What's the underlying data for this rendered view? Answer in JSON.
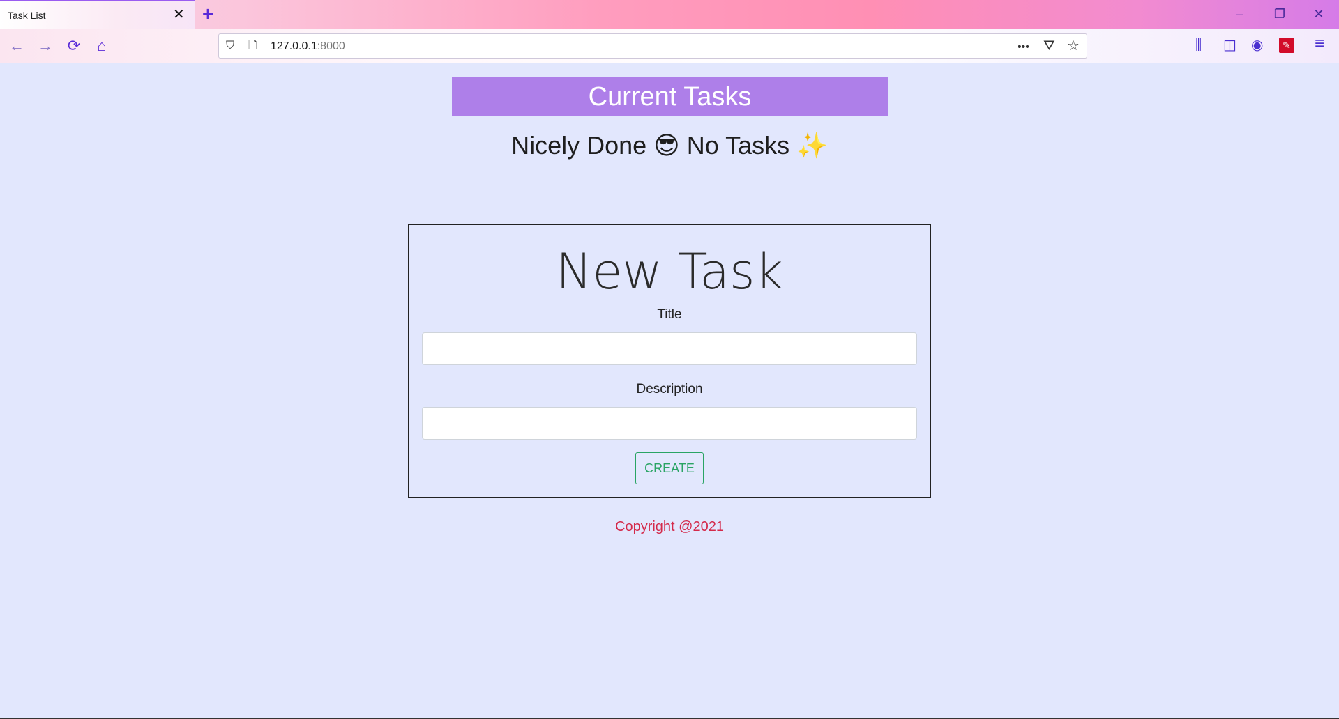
{
  "browser": {
    "tab_title": "Task List",
    "tab_close": "✕",
    "new_tab": "+",
    "window": {
      "minimize": "–",
      "restore": "❐",
      "close": "✕"
    },
    "nav": {
      "back": "←",
      "forward": "→",
      "reload": "⟳",
      "home": "⌂"
    },
    "url_host": "127.0.0.1",
    "url_port": ":8000",
    "url_icons": {
      "shield": "⛉",
      "page": "🗋",
      "more": "•••",
      "pocket": "⛛",
      "star": "☆"
    },
    "toolbar_icons": {
      "library": "⫼",
      "sidebar": "◫",
      "account": "◉",
      "extension": "✎",
      "menu": "≡"
    }
  },
  "page": {
    "header": "Current Tasks",
    "empty_message": "Nicely Done 😎 No Tasks ✨",
    "form": {
      "heading": "New Task",
      "title_label": "Title",
      "title_value": "",
      "description_label": "Description",
      "description_value": "",
      "submit_label": "CREATE"
    },
    "footer": "Copyright @2021"
  },
  "colors": {
    "background": "#e2e7fd",
    "header_bg": "#ae7fe9",
    "create_button": "#2aa464",
    "footer_text": "#d4294a"
  }
}
